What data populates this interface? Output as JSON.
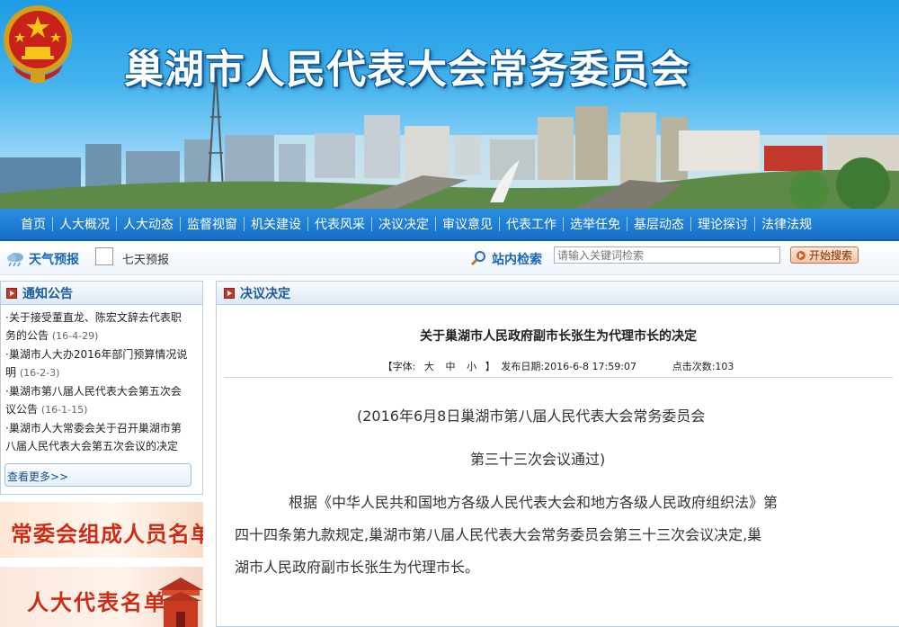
{
  "header": {
    "site_title": "巢湖市人民代表大会常务委员会"
  },
  "nav": {
    "items": [
      "首页",
      "人大概况",
      "人大动态",
      "监督视窗",
      "机关建设",
      "代表风采",
      "决议决定",
      "审议意见",
      "代表工作",
      "选举任免",
      "基层动态",
      "理论探讨",
      "法律法规"
    ]
  },
  "toolbar": {
    "weather_label": "天气预报",
    "forecast_label": "七天预报",
    "search_label": "站内检索",
    "search_placeholder": "请输入关键词检索",
    "search_button": "开始搜索"
  },
  "notice": {
    "title": "通知公告",
    "items": [
      {
        "l1": "·关于接受董直龙、陈宏文辞去代表职",
        "l2": "务的公告",
        "date": "(16-4-29)"
      },
      {
        "l1": "·巢湖市人大办2016年部门预算情况说",
        "l2": "明",
        "date": "(16-2-3)"
      },
      {
        "l1": "·巢湖市第八届人民代表大会第五次会",
        "l2": "议公告",
        "date": "(16-1-15)"
      },
      {
        "l1": "·巢湖市人大常委会关于召开巢湖市第",
        "l2": "八届人民代表大会第五次会议的决定",
        "date": ""
      }
    ],
    "more": "查看更多>>"
  },
  "promos": {
    "members": "常委会组成人员名单",
    "deputies": "人大代表名单"
  },
  "content": {
    "section_title": "决议决定",
    "article_title": "关于巢湖市人民政府副市长张生为代理市长的决定",
    "meta": {
      "font_label": "【字体:",
      "sizes": [
        "大",
        "中",
        "小"
      ],
      "close": "】",
      "publish": "发布日期:2016-6-8 17:59:07",
      "clicks": "点击次数:103"
    },
    "body": [
      "(2016年6月8日巢湖市第八届人民代表大会常务委员会",
      "第三十三次会议通过)",
      "根据《中华人民共和国地方各级人民代表大会和地方各级人民政府组织法》第",
      "四十四条第九款规定,巢湖市第八届人民代表大会常务委员会第三十三次会议决定,巢",
      "湖市人民政府副市长张生为代理市长。"
    ]
  }
}
